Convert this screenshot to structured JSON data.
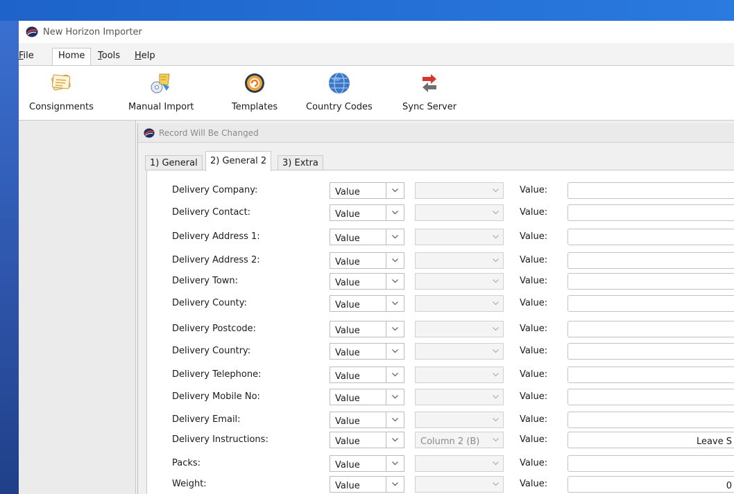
{
  "app": {
    "title": "New Horizon Importer"
  },
  "menu": [
    {
      "label": "File",
      "key": "F",
      "x": 0,
      "active": false
    },
    {
      "label": "Home",
      "key": "",
      "x": 0,
      "active": true
    },
    {
      "label": "Tools",
      "key": "T",
      "x": 0,
      "active": false
    },
    {
      "label": "Help",
      "key": "H",
      "x": 0,
      "active": false
    }
  ],
  "ribbon": [
    {
      "label": "Consignments",
      "icon": "consignments-icon"
    },
    {
      "label": "Manual Import",
      "icon": "manual-import-icon"
    },
    {
      "label": "Templates",
      "icon": "templates-icon"
    },
    {
      "label": "Country Codes",
      "icon": "globe-icon"
    },
    {
      "label": "Sync Server",
      "icon": "sync-arrows-icon"
    }
  ],
  "dialog": {
    "title": "Record Will Be Changed",
    "tabs": [
      {
        "label": "1) General",
        "active": false
      },
      {
        "label": "2) General 2",
        "active": true
      },
      {
        "label": "3) Extra",
        "active": false
      }
    ],
    "value_label": "Value:",
    "rows": [
      {
        "label": "Delivery Company:",
        "source": "Value",
        "column": "",
        "value": ""
      },
      {
        "label": "Delivery Contact:",
        "source": "Value",
        "column": "",
        "value": ""
      },
      {
        "label": "Delivery Address 1:",
        "source": "Value",
        "column": "",
        "value": ""
      },
      {
        "label": "Delivery Address 2:",
        "source": "Value",
        "column": "",
        "value": ""
      },
      {
        "label": "Delivery Town:",
        "source": "Value",
        "column": "",
        "value": ""
      },
      {
        "label": "Delivery County:",
        "source": "Value",
        "column": "",
        "value": ""
      },
      {
        "label": "Delivery Postcode:",
        "source": "Value",
        "column": "",
        "value": ""
      },
      {
        "label": "Delivery Country:",
        "source": "Value",
        "column": "",
        "value": ""
      },
      {
        "label": "Delivery Telephone:",
        "source": "Value",
        "column": "",
        "value": ""
      },
      {
        "label": "Delivery Mobile No:",
        "source": "Value",
        "column": "",
        "value": ""
      },
      {
        "label": "Delivery Email:",
        "source": "Value",
        "column": "",
        "value": ""
      },
      {
        "label": "Delivery Instructions:",
        "source": "Value",
        "column": "Column 2 (B)",
        "value": "Leave S"
      },
      {
        "label": "Packs:",
        "source": "Value",
        "column": "",
        "value": ""
      },
      {
        "label": "Weight:",
        "source": "Value",
        "column": "",
        "value": "0"
      }
    ]
  }
}
